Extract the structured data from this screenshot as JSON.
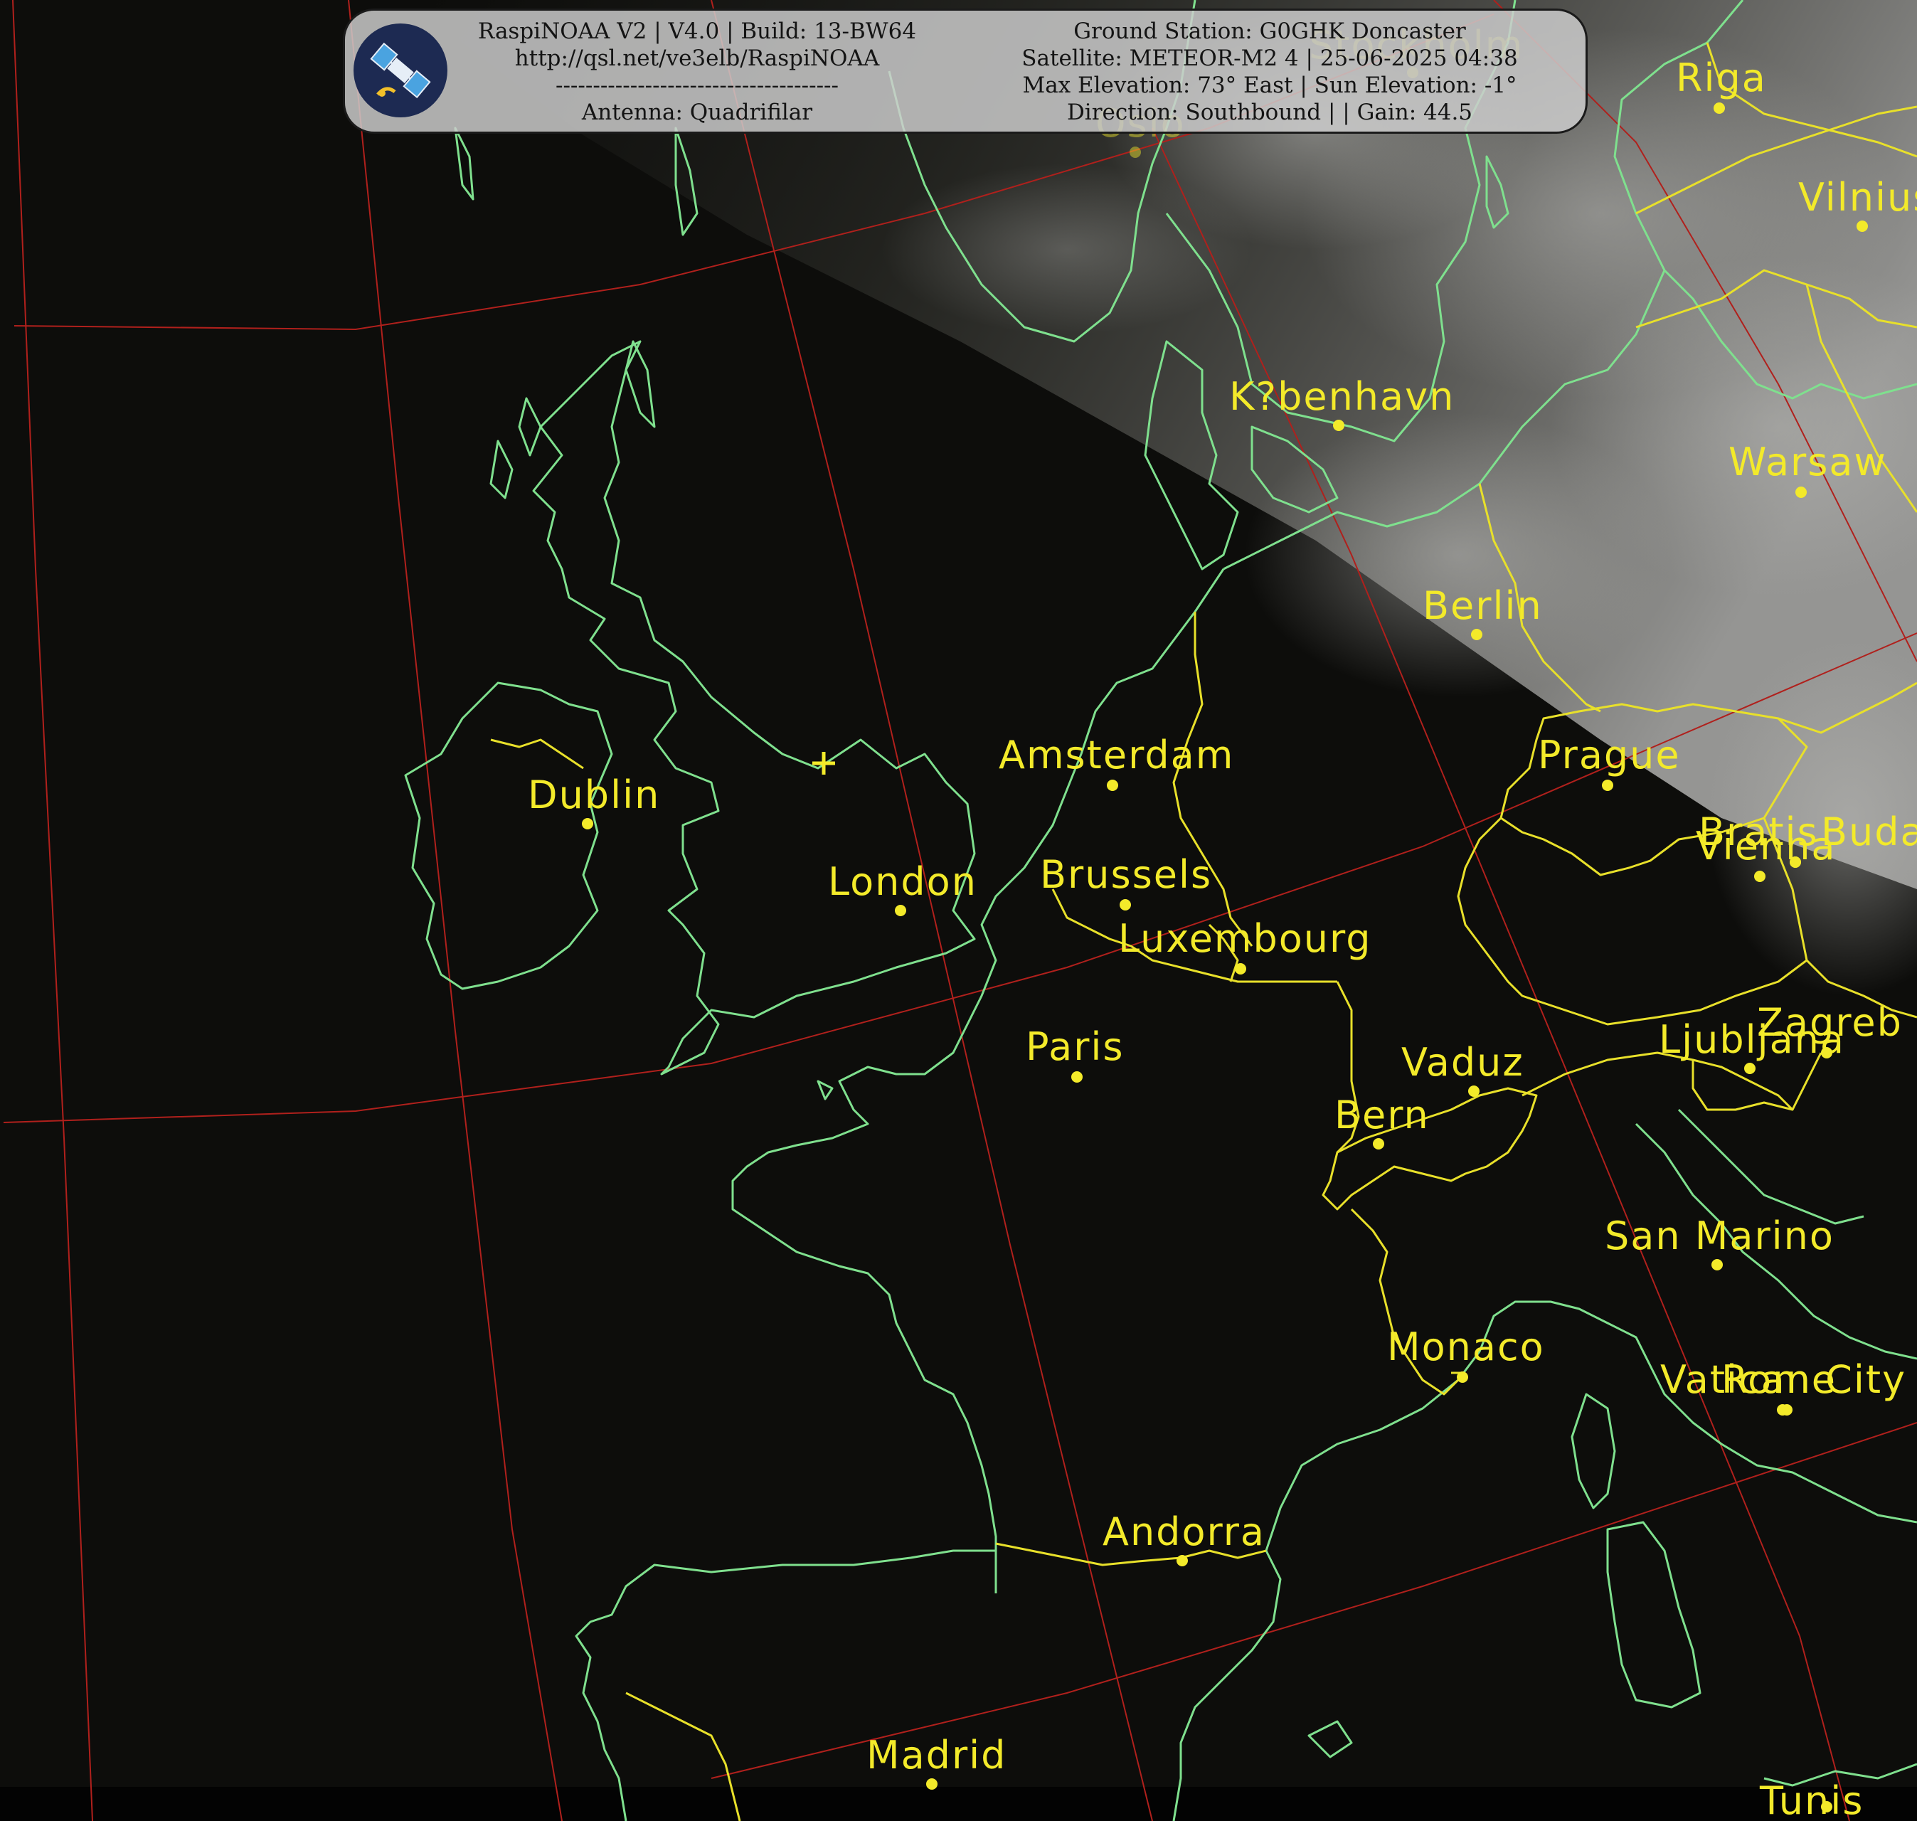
{
  "header": {
    "software": "RaspiNOAA V2 | V4.0 | Build: 13-BW64",
    "url": "http://qsl.net/ve3elb/RaspiNOAA",
    "separator": "--------------------------------------",
    "antenna": "Antenna: Quadrifilar",
    "ground_station": "Ground Station: G0GHK Doncaster",
    "satellite": "Satellite: METEOR-M2 4 | 25-06-2025 04:38",
    "elevation": "Max Elevation: 73° East | Sun Elevation: -1°",
    "direction": "Direction: Southbound | | Gain: 44.5"
  },
  "logo": {
    "icon": "satellite-icon",
    "background": "#1d2a52"
  },
  "map": {
    "colors": {
      "background": "#0d0d0b",
      "coastline": "#7fe08e",
      "border": "#e8e02a",
      "grid": "#b0201c",
      "labels": "#f3ea2a"
    },
    "station_marker": "+",
    "cities": [
      {
        "name": "Riga"
      },
      {
        "name": "Stockholm"
      },
      {
        "name": "Oslo"
      },
      {
        "name": "Vilnius"
      },
      {
        "name": "K?benhavn"
      },
      {
        "name": "Warsaw"
      },
      {
        "name": "Berlin"
      },
      {
        "name": "Amsterdam"
      },
      {
        "name": "Prague"
      },
      {
        "name": "Dublin"
      },
      {
        "name": "Bratis"
      },
      {
        "name": "Buda"
      },
      {
        "name": "Vienna"
      },
      {
        "name": "London"
      },
      {
        "name": "Brussels"
      },
      {
        "name": "Luxembourg"
      },
      {
        "name": "Paris"
      },
      {
        "name": "Zagreb"
      },
      {
        "name": "Ljubljana"
      },
      {
        "name": "Vaduz"
      },
      {
        "name": "Bern"
      },
      {
        "name": "San Marino"
      },
      {
        "name": "Monaco"
      },
      {
        "name": "Vatican City"
      },
      {
        "name": "Rome"
      },
      {
        "name": "Andorra"
      },
      {
        "name": "Madrid"
      },
      {
        "name": "Tunis"
      }
    ]
  }
}
